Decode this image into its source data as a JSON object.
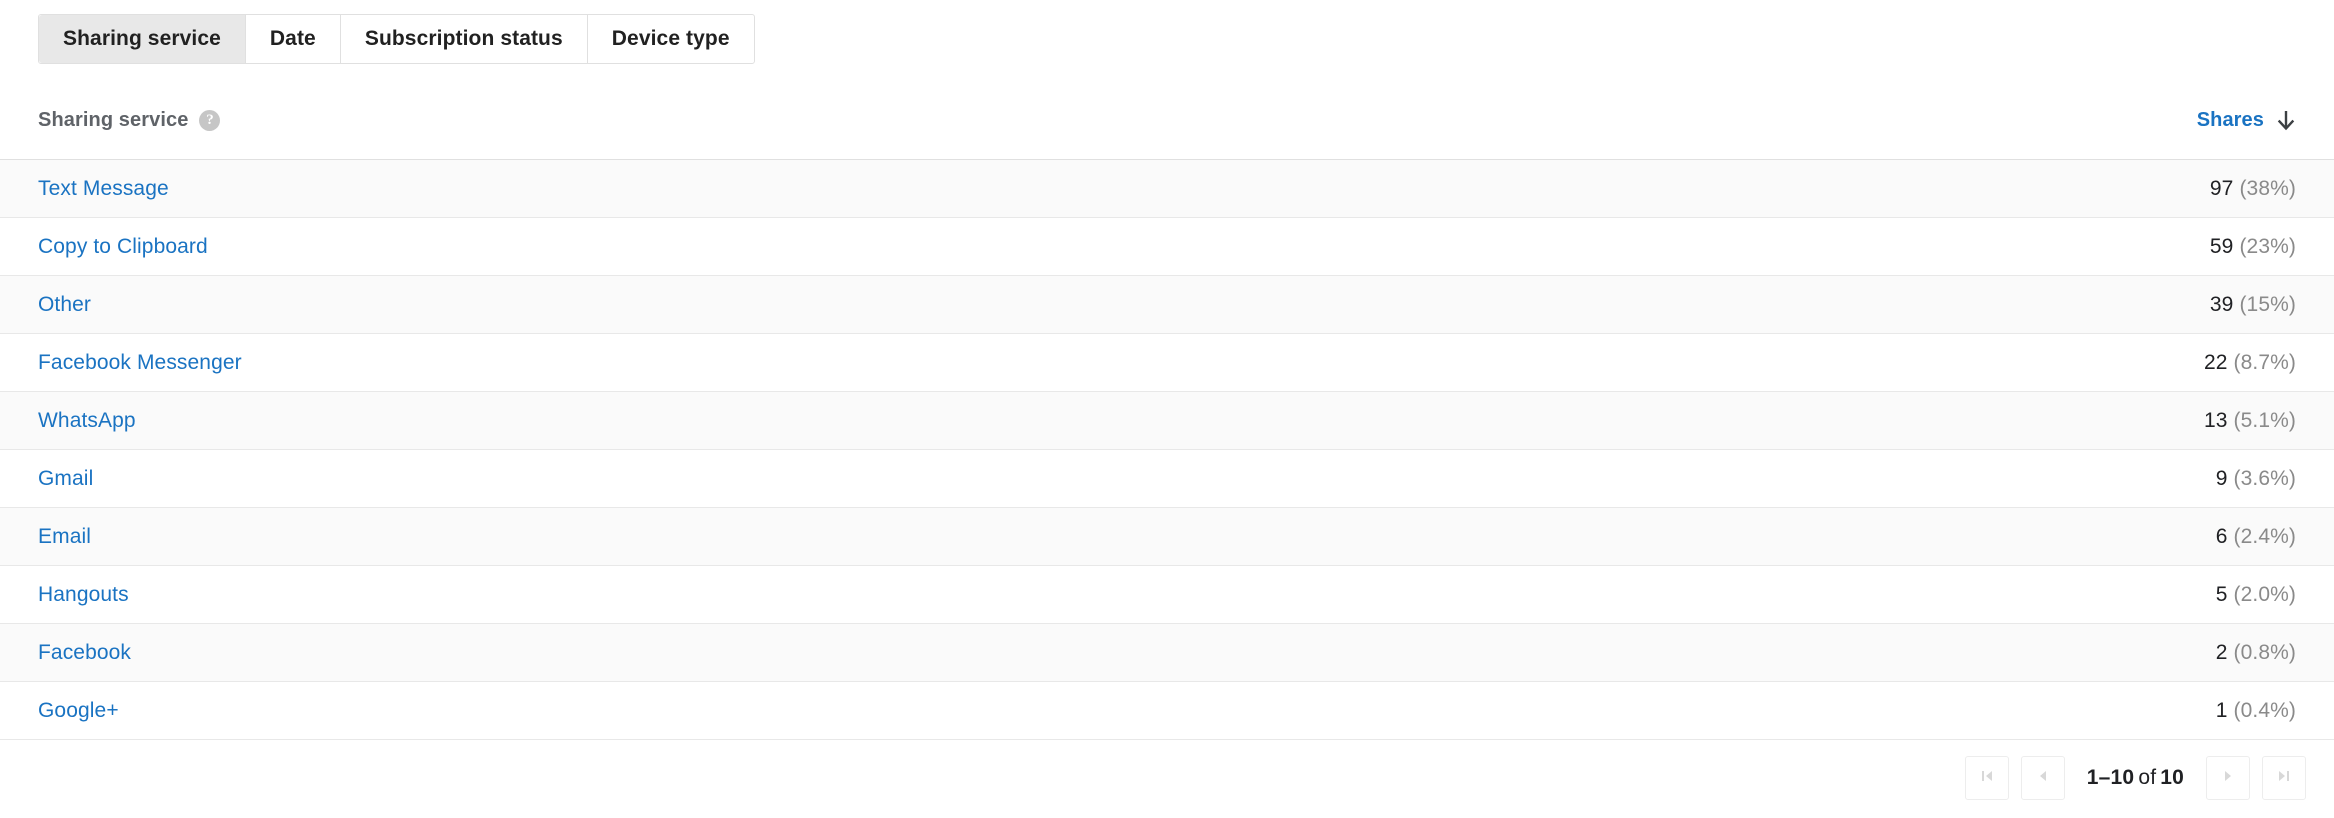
{
  "tabs": [
    {
      "label": "Sharing service",
      "active": true
    },
    {
      "label": "Date",
      "active": false
    },
    {
      "label": "Subscription status",
      "active": false
    },
    {
      "label": "Device type",
      "active": false
    }
  ],
  "table": {
    "dimension_header": "Sharing service",
    "help_icon": "help-question-icon",
    "metric_header": "Shares",
    "sort_icon": "sort-descending-arrow-icon",
    "sort_direction": "descending",
    "rows": [
      {
        "name": "Text Message",
        "value": "97",
        "percent": "(38%)"
      },
      {
        "name": "Copy to Clipboard",
        "value": "59",
        "percent": "(23%)"
      },
      {
        "name": "Other",
        "value": "39",
        "percent": "(15%)"
      },
      {
        "name": "Facebook Messenger",
        "value": "22",
        "percent": "(8.7%)"
      },
      {
        "name": "WhatsApp",
        "value": "13",
        "percent": "(5.1%)"
      },
      {
        "name": "Gmail",
        "value": "9",
        "percent": "(3.6%)"
      },
      {
        "name": "Email",
        "value": "6",
        "percent": "(2.4%)"
      },
      {
        "name": "Hangouts",
        "value": "5",
        "percent": "(2.0%)"
      },
      {
        "name": "Facebook",
        "value": "2",
        "percent": "(0.8%)"
      },
      {
        "name": "Google+",
        "value": "1",
        "percent": "(0.4%)"
      }
    ]
  },
  "pagination": {
    "range_start": "1",
    "range_sep": "–",
    "range_end": "10",
    "of_label": "of",
    "total": "10",
    "range_text": "1–10",
    "first_icon": "first-page-icon",
    "prev_icon": "previous-page-icon",
    "next_icon": "next-page-icon",
    "last_icon": "last-page-icon"
  },
  "colors": {
    "link": "#1a73c2",
    "metric_header": "#1a73c2",
    "dimension_header": "#5f6368",
    "percent": "#8a8a8a",
    "row_shaded": "#fafafa",
    "divider": "#e8e8e8",
    "active_tab": "#e8e8e8"
  }
}
